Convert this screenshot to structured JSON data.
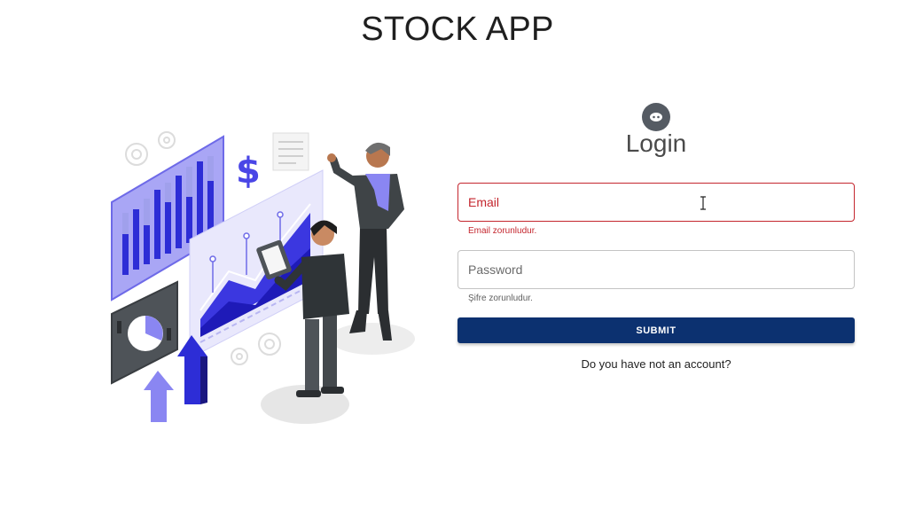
{
  "app": {
    "title": "STOCK APP"
  },
  "illustration": {
    "name": "stock-analytics-illustration"
  },
  "login": {
    "title": "Login",
    "avatar_icon": "user-avatar-icon",
    "email": {
      "placeholder": "Email",
      "value": "",
      "error": "Email zorunludur."
    },
    "password": {
      "placeholder": "Password",
      "value": "",
      "helper": "Şifre zorunludur."
    },
    "submit_label": "SUBMIT",
    "signup_link": "Do you have not an account?"
  },
  "colors": {
    "accent": "#0c3170",
    "error": "#c4262e",
    "illustration_purple": "#7b78f0",
    "illustration_blue": "#2d2dd6"
  }
}
